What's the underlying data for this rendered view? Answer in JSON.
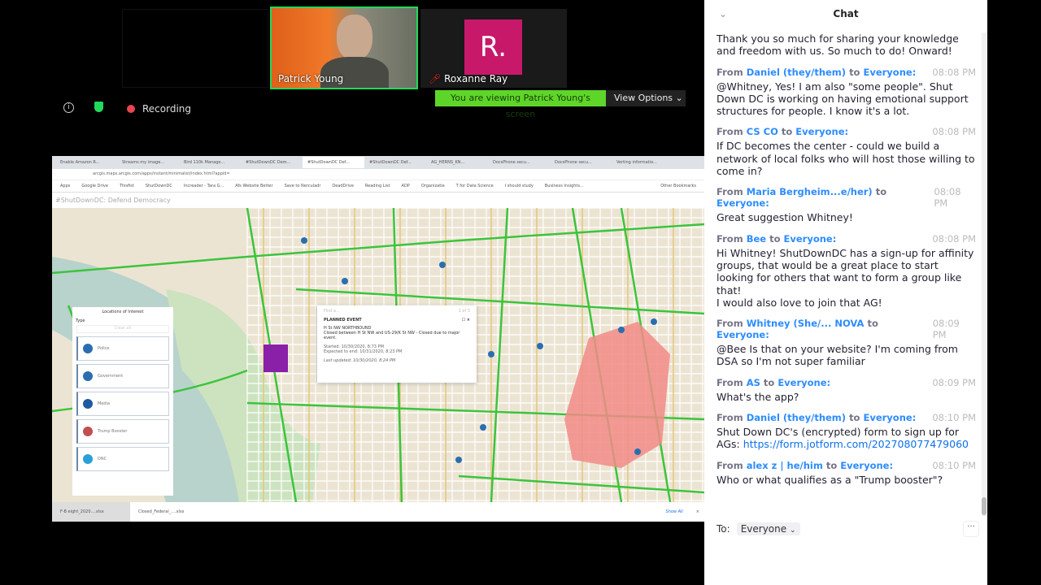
{
  "video": {
    "participants": [
      {
        "name": "Patrick Young",
        "active": true
      },
      {
        "name": "Roxanne Ray",
        "avatar_letter": "R.",
        "avatar_color": "#c8186a",
        "muted": true
      }
    ]
  },
  "meeting_bar": {
    "recording_label": "Recording",
    "viewing_banner": "You are viewing Patrick Young's screen",
    "view_options": "View Options",
    "banner_color": "#5ed629"
  },
  "browser": {
    "tabs": [
      "Enable Amazon R...",
      "Streams my image...",
      "Bird 110k Manage...",
      "#ShutDownDC Dem...",
      "#ShutDownDC Def...",
      "#ShutDownDC Def...",
      "AG_HERNS_KN...",
      "DocsPhone secu...",
      "DocsPhone secu...",
      "Verting informatio..."
    ],
    "address": "arcgis.maps.arcgis.com/apps/instant/minimalist/index.html?appid=",
    "bookmarks": [
      "Apps",
      "Google Drive",
      "Thisfist",
      "ShutDownDC",
      "Increader - Tara G...",
      "Afs Website Better",
      "Save to Nerculadr",
      "DeadDrive",
      "Reading List",
      "ADP",
      "Organizatie",
      "T for Data Science",
      "I should study",
      "Business Insights...",
      "Other Bookmarks"
    ],
    "app_title": "#ShutDownDC: Defend Democracy",
    "downloads": [
      "F-B eight_2020....xlsx",
      "Closed_Federal_....xlsx"
    ],
    "show_all": "Show All"
  },
  "map": {
    "legend": {
      "title": "Locations of Interest",
      "type_label": "Type",
      "clear": "Clear all",
      "items": [
        "Police",
        "Government",
        "Media",
        "Trump Booster",
        "DNC"
      ]
    },
    "popup": {
      "search": "Find a...",
      "pager": "1 of 3",
      "title": "PLANNED EVENT",
      "heading": "H St NW NORTHBOUND",
      "desc": "Closed between H St NW and US-29/K St NW - Closed due to major event.",
      "started": "Started: 10/30/2020, 8:73 PM",
      "expected": "Expected to end: 10/31/2020, 8:23 PM",
      "updated": "Last updated: 10/30/2020, 8:24 PM"
    }
  },
  "chat": {
    "title": "Chat",
    "messages": [
      {
        "from": "",
        "to": "",
        "time": "",
        "text": "Thank you so much for sharing your knowledge and freedom with us. So much to do! Onward!"
      },
      {
        "from": "Daniel (they/them)",
        "to": "Everyone:",
        "time": "08:08 PM",
        "text": "@Whitney, Yes! I am also \"some people\". Shut Down DC is working on having emotional support structures for people. I know it's a lot."
      },
      {
        "from": "CS CO",
        "to": "Everyone:",
        "time": "08:08 PM",
        "text": "If DC becomes the center - could we build a network of local folks who will host those willing to come in?"
      },
      {
        "from": "Maria Bergheim...e/her)",
        "to": "Everyone:",
        "time": "08:08 PM",
        "text": "Great suggestion Whitney!"
      },
      {
        "from": "Bee",
        "to": "Everyone:",
        "time": "08:08 PM",
        "text": "Hi Whitney! ShutDownDC has a sign-up for affinity groups, that would be a great place to start looking for others that want to form a group like that!\nI would also love to join that AG!"
      },
      {
        "from": "Whitney (She/... NOVA",
        "to": "Everyone:",
        "time": "08:09 PM",
        "text": "@Bee Is that on your website? I'm coming from DSA so I'm not super familiar"
      },
      {
        "from": "AS",
        "to": "Everyone:",
        "time": "08:09 PM",
        "text": "What's the app?"
      },
      {
        "from": "Daniel (they/them)",
        "to": "Everyone:",
        "time": "08:10 PM",
        "text": "Shut Down DC's (encrypted) form to sign up for AGs: ",
        "link": "https://form.jotform.com/202708077479060"
      },
      {
        "from": "alex z | he/him",
        "to": "Everyone:",
        "time": "08:10 PM",
        "text": "Who or what qualifies as a \"Trump booster\"?"
      }
    ],
    "from_word": "From",
    "to_word": "to",
    "to_label": "To:",
    "recipient": "Everyone"
  }
}
